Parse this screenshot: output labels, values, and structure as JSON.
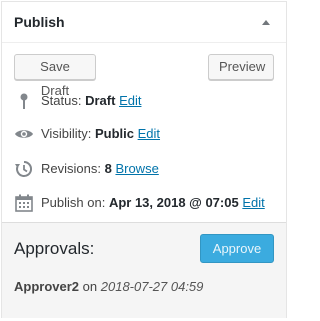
{
  "publish": {
    "title": "Publish",
    "save_draft_label": "Save Draft",
    "preview_label": "Preview",
    "status": {
      "label": "Status:",
      "value": "Draft",
      "edit": "Edit"
    },
    "visibility": {
      "label": "Visibility:",
      "value": "Public",
      "edit": "Edit"
    },
    "revisions": {
      "label": "Revisions:",
      "value": "8",
      "browse": "Browse"
    },
    "publish_on": {
      "label": "Publish on:",
      "value": "Apr 13, 2018 @ 07:05",
      "edit": "Edit"
    }
  },
  "approvals": {
    "heading": "Approvals:",
    "approve_label": "Approve",
    "entry": {
      "name": "Approver2",
      "on": "on",
      "date": "2018-07-27 04:59"
    }
  },
  "colors": {
    "link": "#0073aa",
    "approve_button": "#27a4dd",
    "approvals_bg": "#f5f5f5"
  },
  "icons": {
    "toggle": "triangle-up-icon",
    "status": "pin-icon",
    "visibility": "eye-icon",
    "revisions": "history-icon",
    "publish_on": "calendar-icon"
  }
}
